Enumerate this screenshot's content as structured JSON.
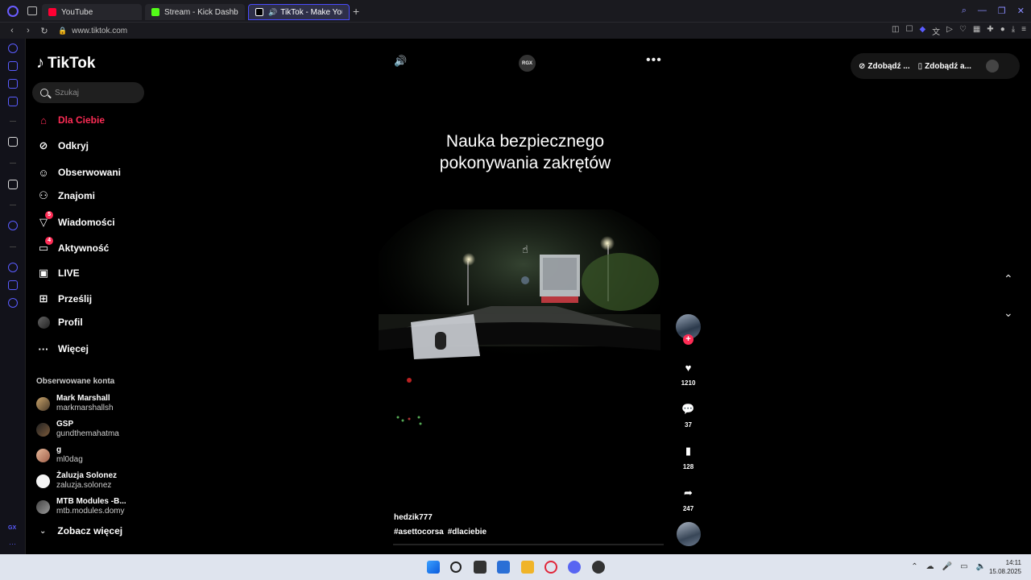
{
  "browser": {
    "tabs": [
      {
        "label": "YouTube",
        "color": "#ff0033",
        "active": false
      },
      {
        "label": "Stream - Kick Dashboard",
        "color": "#53fc18",
        "active": false
      },
      {
        "label": "TikTok - Make Your Da",
        "color": "#ffffff",
        "active": true
      }
    ],
    "new_tab": "+",
    "url": "www.tiktok.com"
  },
  "tiktok": {
    "logo_text": "TikTok",
    "search_placeholder": "Szukaj",
    "nav": [
      {
        "label": "Dla Ciebie",
        "icon": "home-icon",
        "active": true
      },
      {
        "label": "Odkryj",
        "icon": "compass-icon"
      },
      {
        "label": "Obserwowani",
        "icon": "following-icon"
      },
      {
        "label": "Znajomi",
        "icon": "friends-icon"
      },
      {
        "label": "Wiadomości",
        "icon": "inbox-icon",
        "badge": "5"
      },
      {
        "label": "Aktywność",
        "icon": "activity-icon",
        "badge": "4"
      },
      {
        "label": "LIVE",
        "icon": "live-icon"
      },
      {
        "label": "Prześlij",
        "icon": "upload-icon"
      },
      {
        "label": "Profil",
        "icon": "profile-avatar-icon"
      },
      {
        "label": "Więcej",
        "icon": "more-dots-icon"
      }
    ],
    "followed_title": "Obserwowane konta",
    "followed": [
      {
        "name": "Mark Marshall",
        "handle": "markmarshallsh"
      },
      {
        "name": "GSP",
        "handle": "gundthemahatma"
      },
      {
        "name": "g",
        "handle": "ml0dag"
      },
      {
        "name": "Żaluzja Solonez",
        "handle": "zaluzja.solonez"
      },
      {
        "name": "MTB Modules -B...",
        "handle": "mtb.modules.domy"
      }
    ],
    "see_more": "Zobacz więcej",
    "top_buttons": [
      "Zdobądź ...",
      "Zdobądź a..."
    ],
    "video": {
      "overlay_badge": "RGX",
      "caption_line1": "Nauka bezpiecznego",
      "caption_line2": "pokonywania zakrętów",
      "author": "hedzik777",
      "tags": [
        "#asettocorsa",
        "#dlaciebie"
      ],
      "likes": "1210",
      "comments": "37",
      "saves": "128",
      "shares": "247"
    }
  },
  "taskbar": {
    "time": "14:11",
    "date": "15.08.2025"
  },
  "colors": {
    "accent": "#fe2c55",
    "opera": "#5a5cff"
  }
}
